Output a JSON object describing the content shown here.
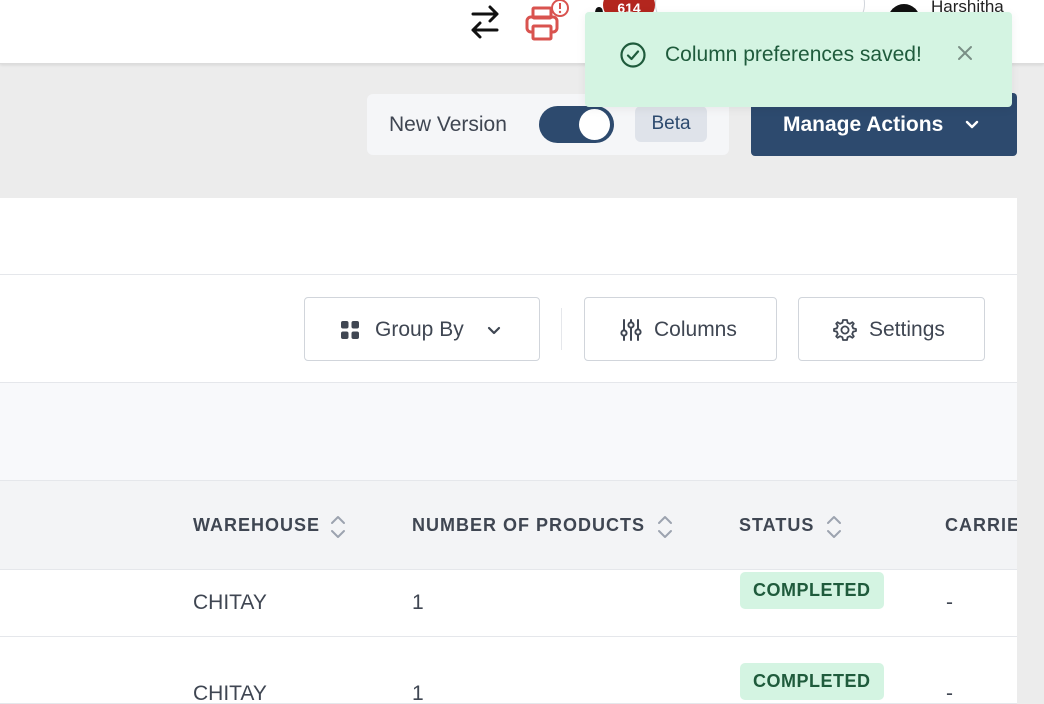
{
  "header": {
    "notification_count": "614",
    "user_name": "Harshitha"
  },
  "toast": {
    "message": "Column preferences saved!"
  },
  "actions": {
    "new_version_label": "New Version",
    "new_version_enabled": true,
    "beta_label": "Beta",
    "manage_actions_label": "Manage Actions"
  },
  "toolbar": {
    "group_by_label": "Group By",
    "columns_label": "Columns",
    "settings_label": "Settings"
  },
  "table": {
    "columns": [
      "WAREHOUSE",
      "NUMBER OF PRODUCTS",
      "STATUS",
      "CARRIE"
    ],
    "rows": [
      {
        "warehouse": "CHITAY",
        "num_products": "1",
        "status": "COMPLETED",
        "carrier": "-"
      },
      {
        "warehouse": "CHITAY",
        "num_products": "1",
        "status": "COMPLETED",
        "carrier": "-"
      }
    ]
  },
  "colors": {
    "primary": "#2d4a6e",
    "success_bg": "#d4f4e2",
    "success_text": "#1f5b3c",
    "alert_red": "#d9534f",
    "badge_red": "#b3261e"
  },
  "icons": [
    "swap-arrows-icon",
    "printer-alert-icon",
    "bell-icon",
    "check-circle-icon",
    "close-icon",
    "chevron-down-icon",
    "grid-icon",
    "sliders-icon",
    "gear-icon",
    "sort-icon"
  ]
}
